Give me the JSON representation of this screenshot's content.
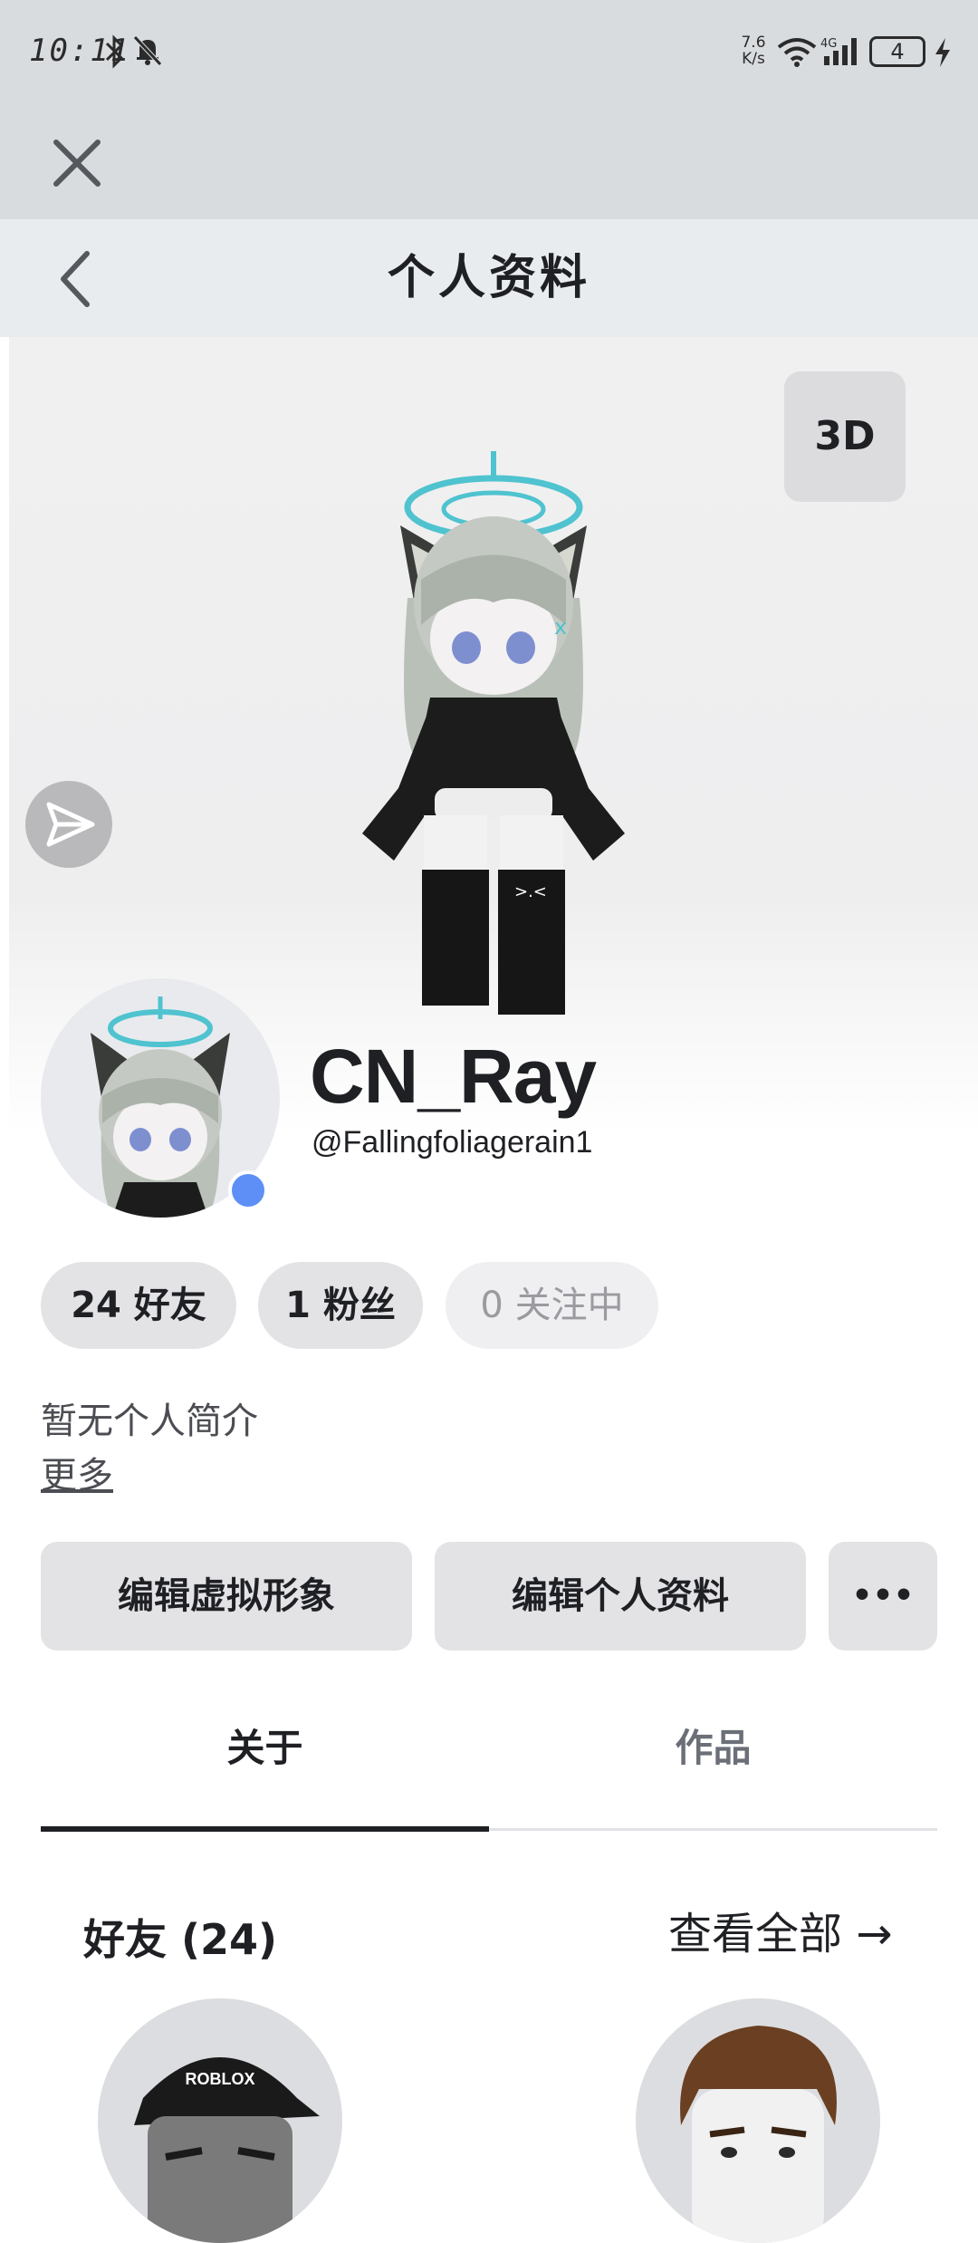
{
  "status_bar": {
    "time": "10:11",
    "net_speed_value": "7.6",
    "net_speed_unit": "K/s",
    "network_type": "4G",
    "battery_level": "4",
    "icons": [
      "bluetooth-icon",
      "mute-icon",
      "wifi-icon",
      "signal-icon",
      "battery-icon",
      "charging-icon"
    ]
  },
  "header": {
    "title": "个人资料",
    "close_icon": "close-icon",
    "back_icon": "chevron-left-icon"
  },
  "stage": {
    "view_3d_label": "3D",
    "share_icon": "share-icon"
  },
  "profile": {
    "display_name": "CN_Ray",
    "username": "@Fallingfoliagerain1",
    "online_status_color": "#5e8ff7"
  },
  "stats": {
    "friends": "24 好友",
    "followers": "1 粉丝",
    "following": "0 关注中"
  },
  "bio": {
    "text": "暂无个人简介",
    "more_label": "更多"
  },
  "actions": {
    "edit_avatar": "编辑虚拟形象",
    "edit_profile": "编辑个人资料",
    "more": "•••"
  },
  "tabs": [
    {
      "label": "关于",
      "active": true
    },
    {
      "label": "作品",
      "active": false
    }
  ],
  "friends_section": {
    "title": "好友 (24)",
    "view_all": "查看全部 →",
    "friend_1_cap_text": "ROBLOX"
  },
  "colors": {
    "status_bg": "#d9dcdf",
    "header_bg": "#e8ecef",
    "chip_bg": "#e3e3e6",
    "accent_blue": "#5e8ff7"
  }
}
